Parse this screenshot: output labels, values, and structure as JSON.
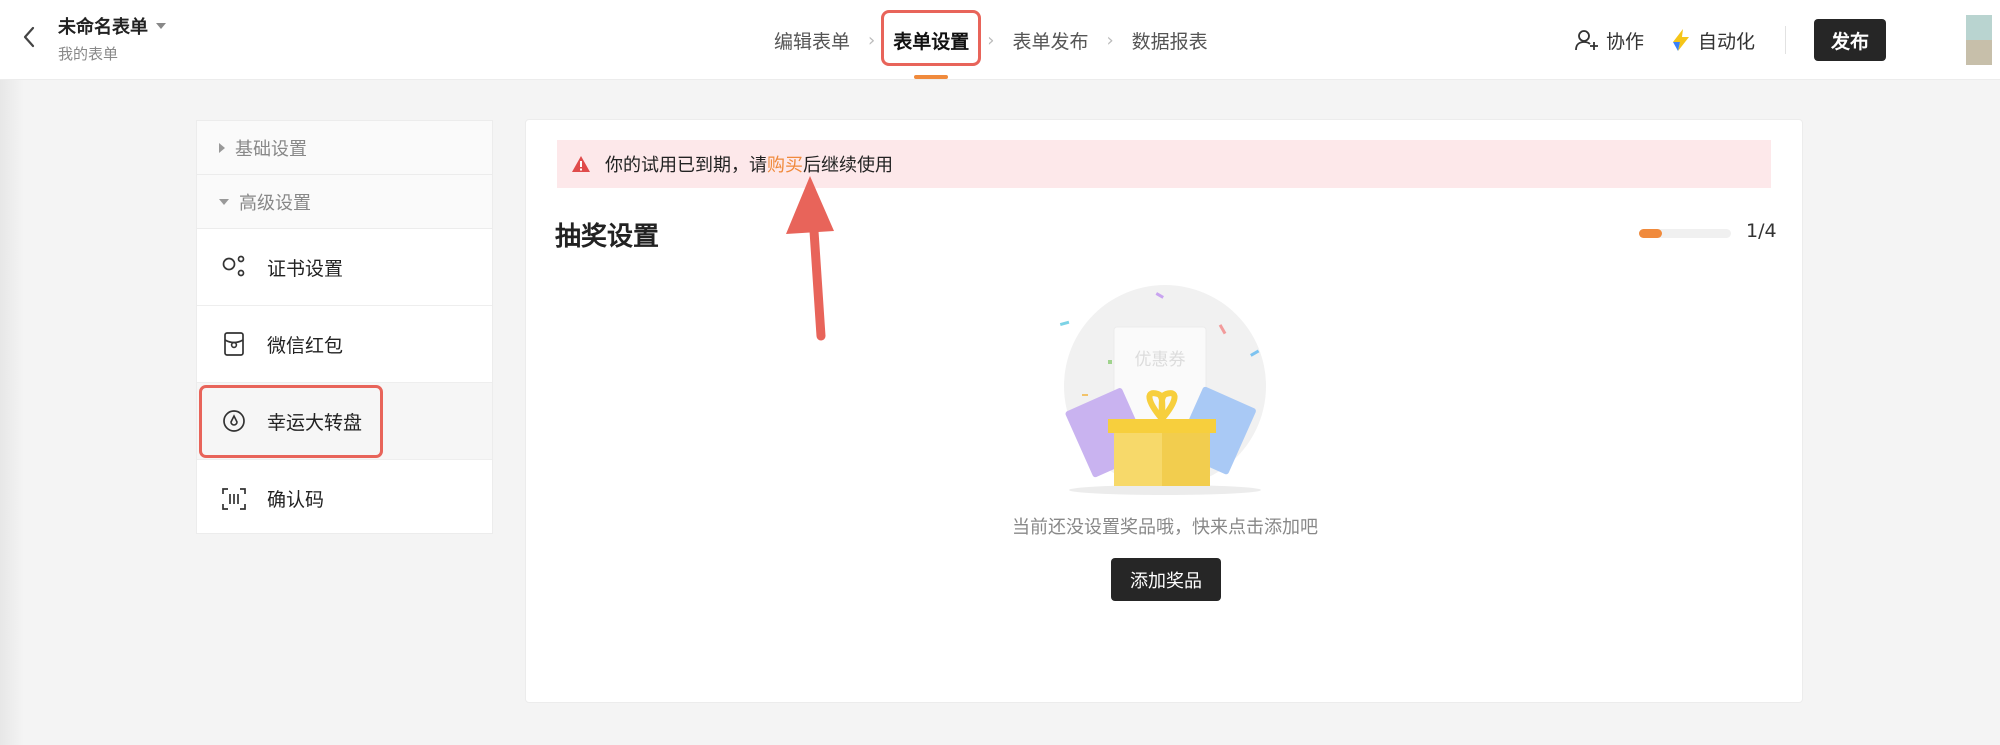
{
  "header": {
    "title": "未命名表单",
    "subtitle": "我的表单",
    "steps": [
      {
        "label": "编辑表单"
      },
      {
        "label": "表单设置"
      },
      {
        "label": "表单发布"
      },
      {
        "label": "数据报表"
      }
    ],
    "collab_label": "协作",
    "automation_label": "自动化",
    "publish_label": "发布"
  },
  "sidebar": {
    "basic_label": "基础设置",
    "advanced_label": "高级设置",
    "items": [
      {
        "label": "证书设置",
        "icon": "share-nodes-icon"
      },
      {
        "label": "微信红包",
        "icon": "red-packet-icon"
      },
      {
        "label": "幸运大转盘",
        "icon": "lucky-wheel-icon"
      },
      {
        "label": "确认码",
        "icon": "scan-code-icon"
      }
    ]
  },
  "main": {
    "alert": {
      "text_before": "你的试用已到期，请",
      "link": "购买",
      "text_after": "后继续使用"
    },
    "section_title": "抽奖设置",
    "progress": {
      "value": 0.25,
      "label": "1/4"
    },
    "coupon_text": "优惠券",
    "empty_text": "当前还没设置奖品哦，快来点击添加吧",
    "add_button": "添加奖品"
  },
  "colors": {
    "accent": "#f08a3c",
    "highlight": "#e8645a",
    "dark_button": "#262626",
    "alert_bg": "#fde8ea"
  }
}
